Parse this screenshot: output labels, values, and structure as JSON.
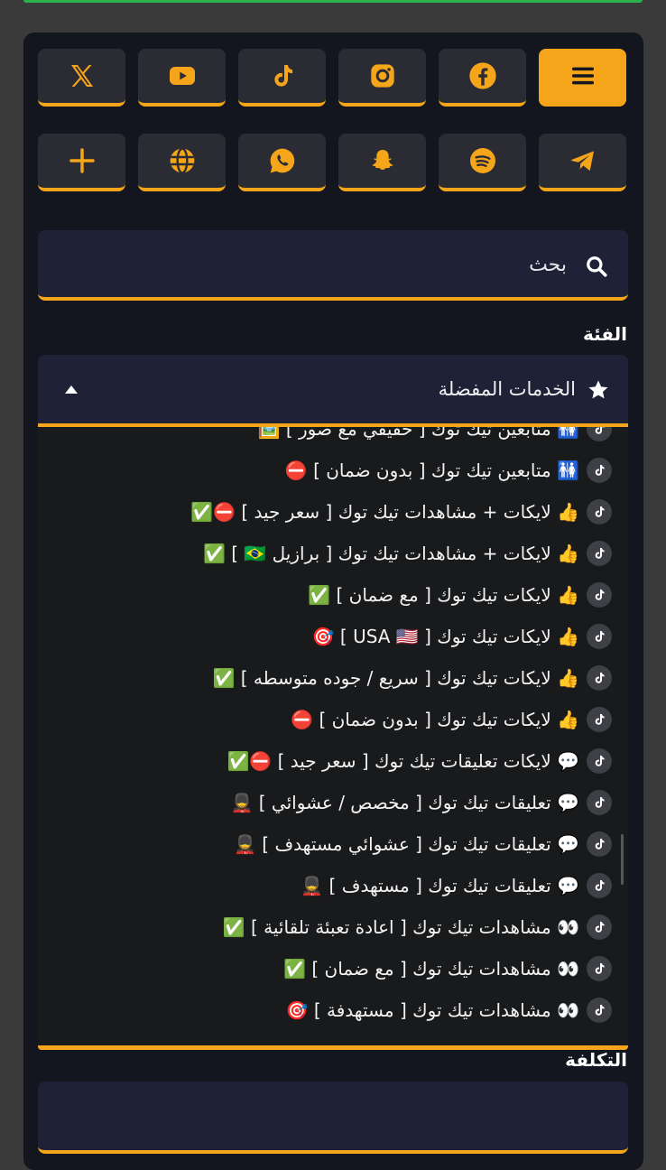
{
  "social_buttons": {
    "row1": [
      {
        "name": "menu-icon",
        "active": true
      },
      {
        "name": "facebook-icon"
      },
      {
        "name": "instagram-icon"
      },
      {
        "name": "tiktok-icon"
      },
      {
        "name": "youtube-icon"
      },
      {
        "name": "x-twitter-icon"
      }
    ],
    "row2": [
      {
        "name": "telegram-icon"
      },
      {
        "name": "spotify-icon"
      },
      {
        "name": "snapchat-icon"
      },
      {
        "name": "whatsapp-icon"
      },
      {
        "name": "globe-icon"
      },
      {
        "name": "plus-icon"
      }
    ]
  },
  "search": {
    "placeholder": "بحث"
  },
  "category": {
    "label": "الفئة",
    "selected": "الخدمات المفضلة",
    "options": [
      "🚻 متابعين تيك توك [ حقيقي مع صور ] 🖼️",
      "🚻 متابعين تيك توك [ بدون ضمان ] ⛔",
      "👍 لايكات + مشاهدات تيك توك [ سعر جيد ] ⛔✅",
      "👍 لايكات + مشاهدات تيك توك [ برازيل 🇧🇷 ] ✅",
      "👍 لايكات تيك توك [ مع ضمان ] ✅",
      "👍 لايكات تيك توك [ USA 🇺🇸 ] 🎯",
      "👍 لايكات تيك توك [ سريع / جوده متوسطه ] ✅",
      "👍 لايكات تيك توك [ بدون ضمان ] ⛔",
      "💬 لايكات تعليقات تيك توك [ سعر جيد ] ⛔✅",
      "💬 تعليقات تيك توك [ مخصص / عشوائي ] 💂",
      "💬 تعليقات تيك توك [ عشوائي مستهدف ] 💂",
      "💬 تعليقات تيك توك [ مستهدف ] 💂",
      "👀 مشاهدات تيك توك [ اعادة تعبئة تلقائية ] ✅",
      "👀 مشاهدات تيك توك [ مع ضمان ] ✅",
      "👀 مشاهدات تيك توك [ مستهدفة ] 🎯"
    ]
  },
  "cost": {
    "label": "التكلفة",
    "value": ""
  },
  "colors": {
    "accent": "#f5a519",
    "panel": "#14161f",
    "field": "#1f2137"
  }
}
